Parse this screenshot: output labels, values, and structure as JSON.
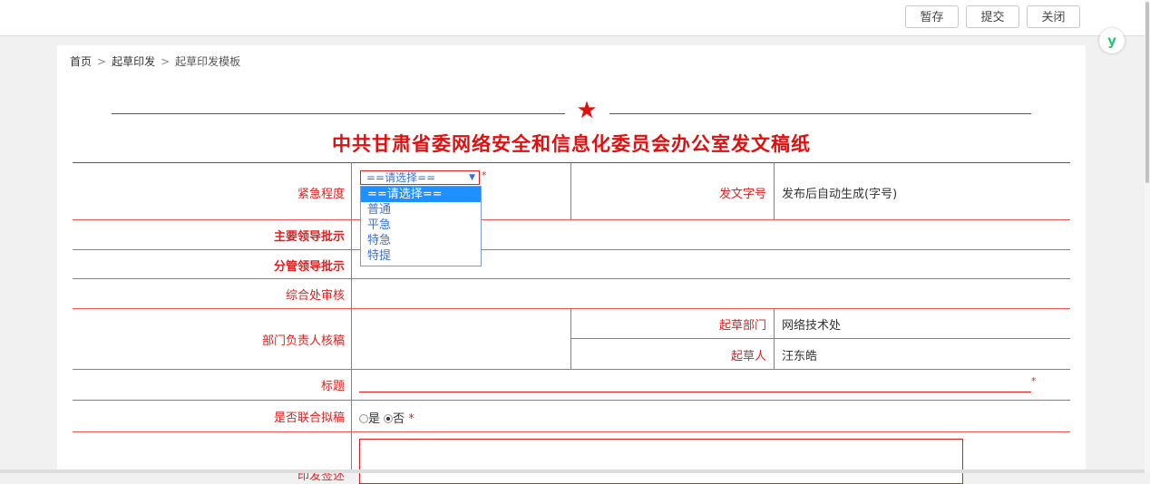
{
  "toolbar": {
    "save_draft": "暂存",
    "submit": "提交",
    "close": "关闭"
  },
  "float_button": {
    "icon": "y-logo-icon",
    "glyph": "y"
  },
  "breadcrumb": {
    "home": "首页",
    "level1": "起草印发",
    "level2": "起草印发模板",
    "separator": ">"
  },
  "document": {
    "star": "★",
    "title": "中共甘肃省委网络安全和信息化委员会办公室发文稿纸"
  },
  "form": {
    "urgency": {
      "label": "紧急程度",
      "selected": "==请选择==",
      "required": "*",
      "options": [
        "==请选择==",
        "普通",
        "平急",
        "特急",
        "特提"
      ]
    },
    "doc_number": {
      "label": "发文字号",
      "value": "发布后自动生成(字号)"
    },
    "main_leader": {
      "label": "主要领导批示"
    },
    "deputy_leader": {
      "label": "分管领导批示"
    },
    "general_review": {
      "label": "综合处审核"
    },
    "dept_head_review": {
      "label": "部门负责人核稿"
    },
    "drafting_dept": {
      "label": "起草部门",
      "value": "网络技术处"
    },
    "drafter": {
      "label": "起草人",
      "value": "汪东皓"
    },
    "title_field": {
      "label": "标题",
      "value": "",
      "required": "*"
    },
    "joint_draft": {
      "label": "是否联合拟稿",
      "yes": "是",
      "no": "否",
      "selected": "否",
      "required": "*"
    },
    "distribution": {
      "label": "印发签述"
    }
  },
  "colors": {
    "accent": "#e02020",
    "link": "#3a6fd8",
    "highlight": "#1e90ff"
  }
}
